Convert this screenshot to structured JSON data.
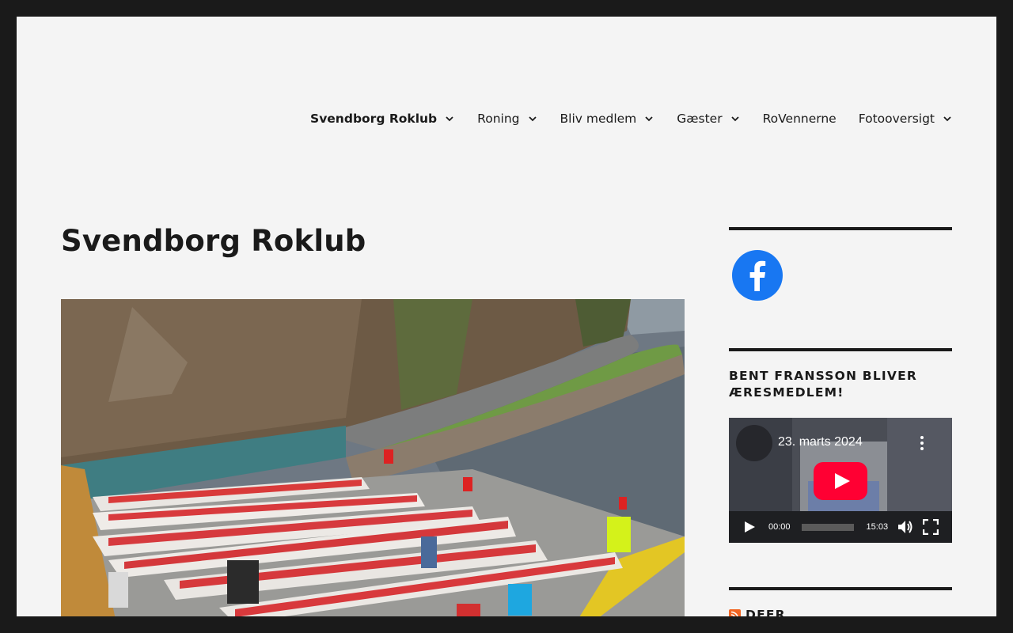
{
  "nav": {
    "items": [
      {
        "label": "Svendborg Roklub",
        "current": true,
        "has_dropdown": true
      },
      {
        "label": "Roning",
        "has_dropdown": true
      },
      {
        "label": "Bliv medlem",
        "has_dropdown": true
      },
      {
        "label": "Gæster",
        "has_dropdown": true
      },
      {
        "label": "RoVennerne",
        "has_dropdown": false
      },
      {
        "label": "Fotooversigt",
        "has_dropdown": true
      }
    ]
  },
  "page": {
    "title": "Svendborg Roklub"
  },
  "sidebar": {
    "facebook_icon": "facebook-icon",
    "facebook_color": "#1877f2",
    "video_widget": {
      "title": "BENT FRANSSON BLIVER ÆRESMEDLEM!",
      "video_title": "23. marts 2024",
      "current_time": "00:00",
      "duration": "15:03"
    },
    "rss_widget": {
      "title": "DFFR"
    }
  },
  "colors": {
    "page_bg": "#f4f4f4",
    "frame": "#1a1a1a",
    "youtube_red": "#ff0033",
    "rss_orange": "#f26522"
  }
}
